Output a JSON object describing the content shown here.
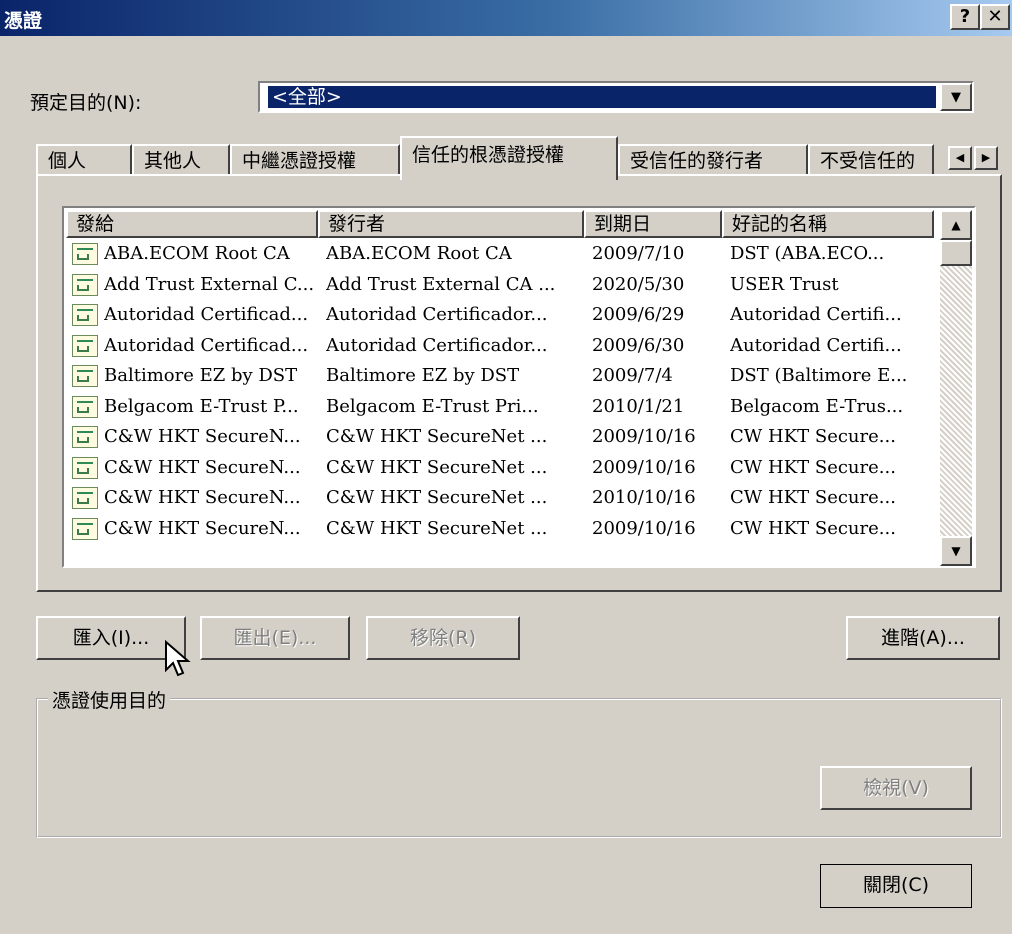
{
  "window": {
    "title": "憑證",
    "help_label": "?",
    "close_label": "✕"
  },
  "purpose": {
    "label": "預定目的(N):",
    "selected": "<全部>"
  },
  "tabs": [
    {
      "label": "個人"
    },
    {
      "label": "其他人"
    },
    {
      "label": "中繼憑證授權"
    },
    {
      "label": "信任的根憑證授權"
    },
    {
      "label": "受信任的發行者"
    },
    {
      "label": "不受信任的"
    }
  ],
  "active_tab": 3,
  "list": {
    "columns": [
      "發給",
      "發行者",
      "到期日",
      "好記的名稱"
    ],
    "rows": [
      {
        "issued_to": "ABA.ECOM Root CA",
        "issued_by": "ABA.ECOM Root CA",
        "expires": "2009/7/10",
        "friendly": "DST (ABA.ECO..."
      },
      {
        "issued_to": "Add Trust External C...",
        "issued_by": "Add Trust External CA ...",
        "expires": "2020/5/30",
        "friendly": "USER Trust"
      },
      {
        "issued_to": "Autoridad Certificad...",
        "issued_by": "Autoridad Certificador...",
        "expires": "2009/6/29",
        "friendly": "Autoridad Certifi..."
      },
      {
        "issued_to": "Autoridad Certificad...",
        "issued_by": "Autoridad Certificador...",
        "expires": "2009/6/30",
        "friendly": "Autoridad Certifi..."
      },
      {
        "issued_to": "Baltimore EZ by DST",
        "issued_by": "Baltimore EZ by DST",
        "expires": "2009/7/4",
        "friendly": "DST (Baltimore E..."
      },
      {
        "issued_to": "Belgacom E-Trust P...",
        "issued_by": "Belgacom E-Trust Pri...",
        "expires": "2010/1/21",
        "friendly": "Belgacom E-Trus..."
      },
      {
        "issued_to": "C&W HKT SecureN...",
        "issued_by": "C&W HKT SecureNet ...",
        "expires": "2009/10/16",
        "friendly": "CW HKT Secure..."
      },
      {
        "issued_to": "C&W HKT SecureN...",
        "issued_by": "C&W HKT SecureNet ...",
        "expires": "2009/10/16",
        "friendly": "CW HKT Secure..."
      },
      {
        "issued_to": "C&W HKT SecureN...",
        "issued_by": "C&W HKT SecureNet ...",
        "expires": "2010/10/16",
        "friendly": "CW HKT Secure..."
      },
      {
        "issued_to": "C&W HKT SecureN...",
        "issued_by": "C&W HKT SecureNet ...",
        "expires": "2009/10/16",
        "friendly": "CW HKT Secure..."
      }
    ]
  },
  "buttons": {
    "import": "匯入(I)...",
    "export": "匯出(E)...",
    "remove": "移除(R)",
    "advanced": "進階(A)...",
    "view": "檢視(V)",
    "close": "關閉(C)"
  },
  "usage_group": {
    "label": "憑證使用目的"
  },
  "icons": {
    "cert": "certificate-icon",
    "scroll_up": "arrow-up-icon",
    "scroll_down": "arrow-down-icon",
    "tab_left": "arrow-left-icon",
    "tab_right": "arrow-right-icon",
    "dropdown": "chevron-down-icon",
    "cursor": "mouse-pointer-icon"
  },
  "colors": {
    "title_gradient_start": "#0a246a",
    "title_gradient_end": "#a6caf0",
    "face": "#d4d0c8",
    "selection": "#0a246a"
  }
}
